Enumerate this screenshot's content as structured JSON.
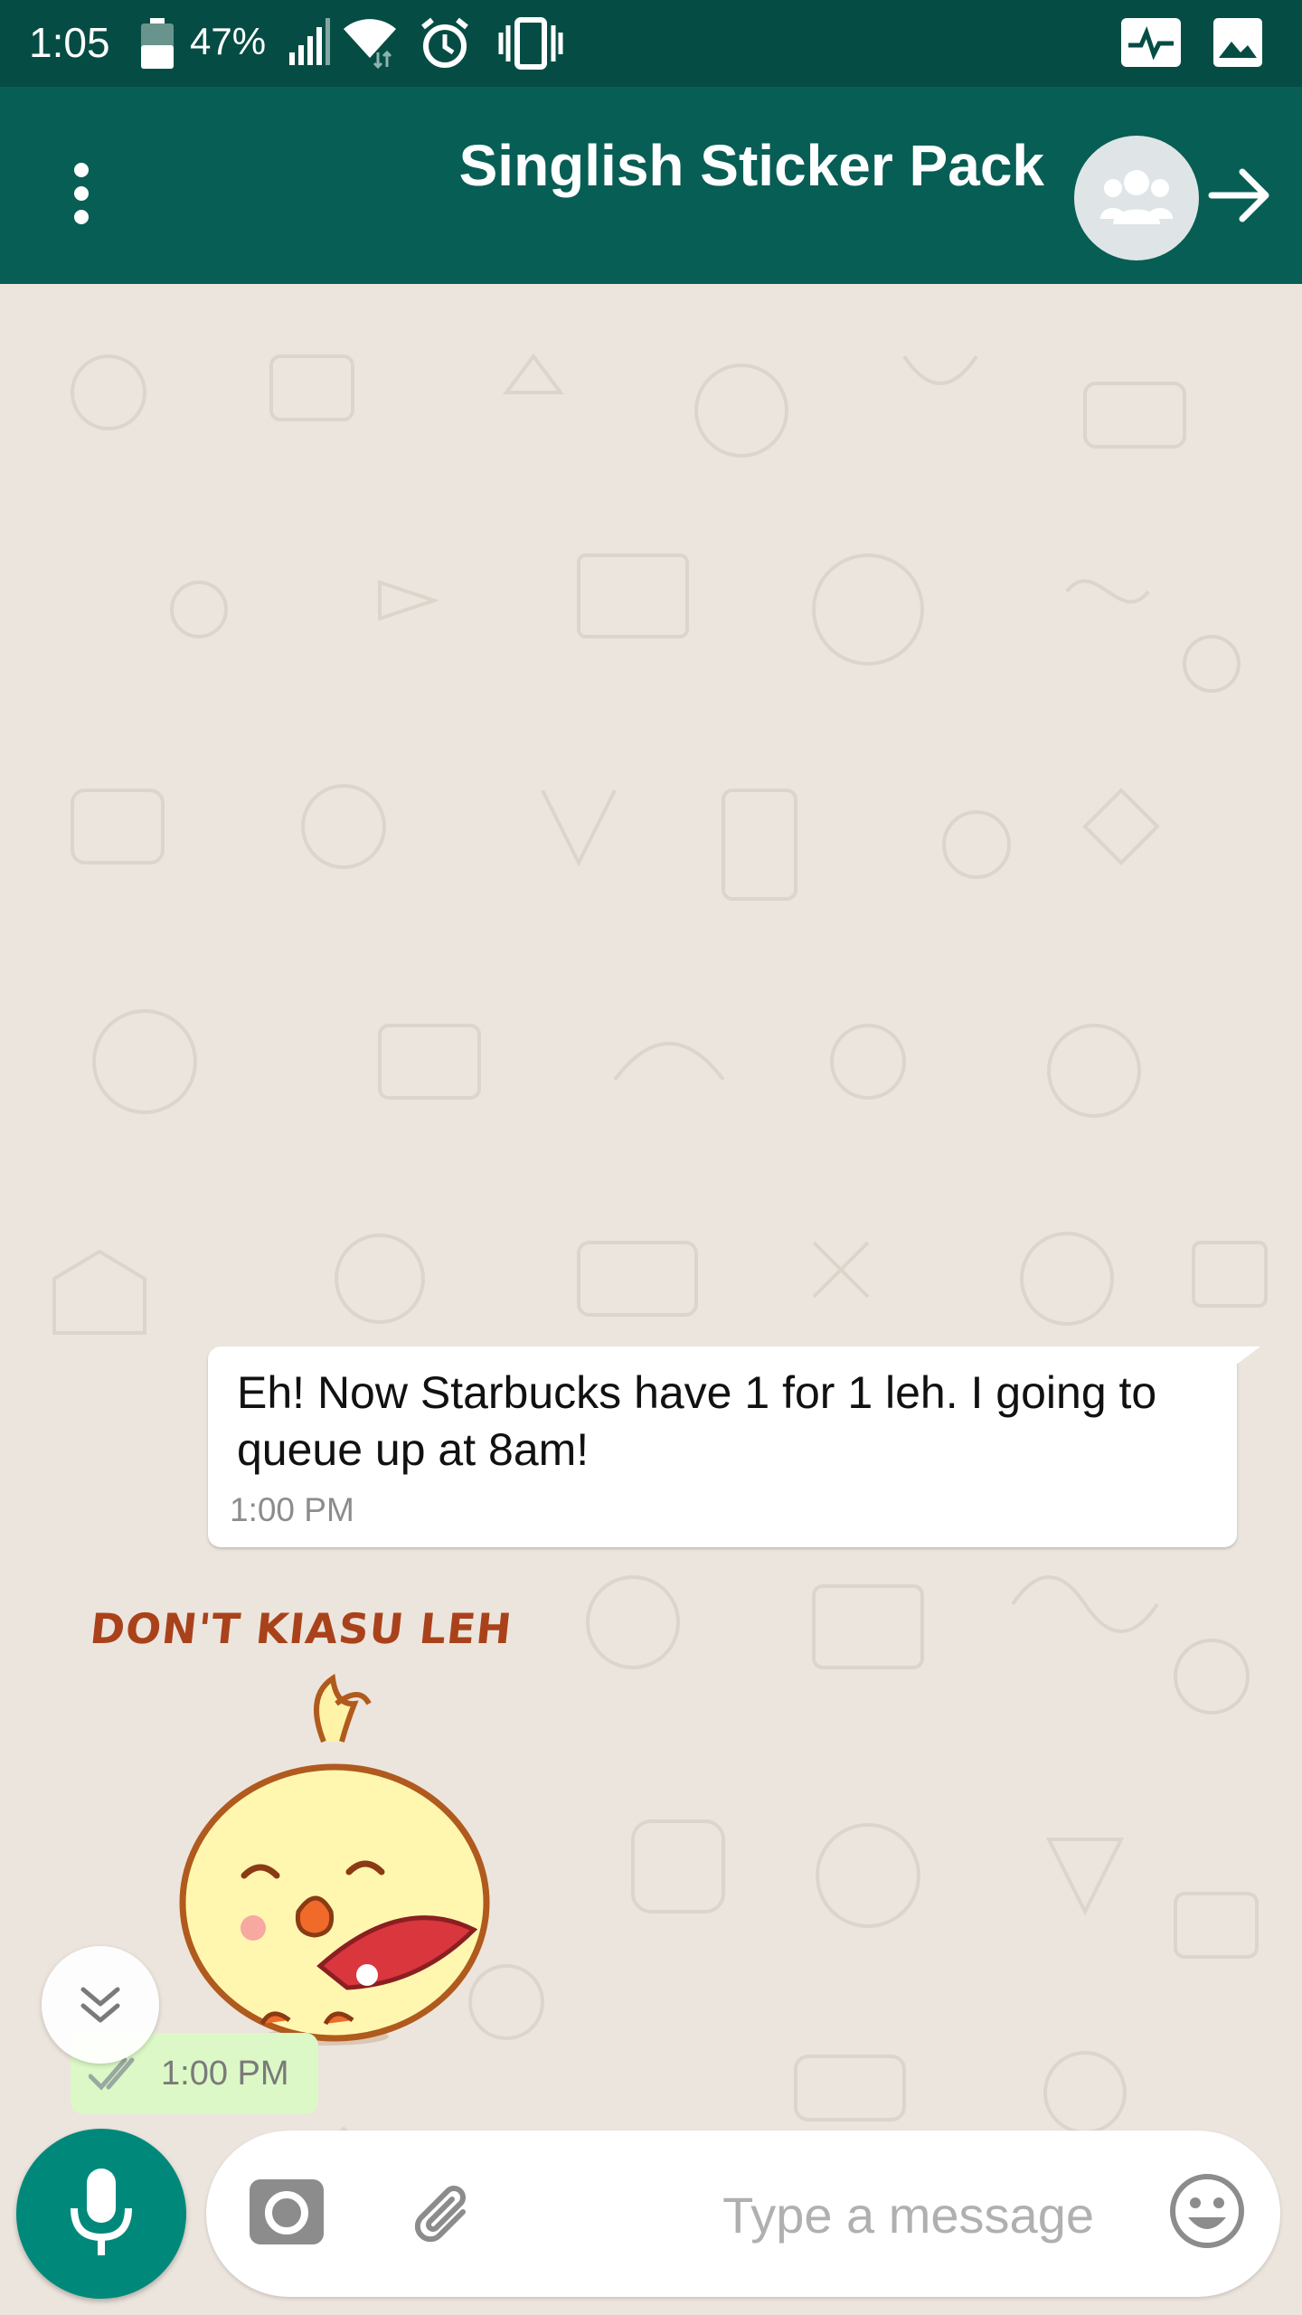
{
  "status_bar": {
    "time": "1:05",
    "battery_percent": "47%"
  },
  "app_bar": {
    "title": "Singlish Sticker Pack",
    "menu_icon": "more-vert-icon",
    "avatar_icon": "group-avatar-icon",
    "forward_icon": "arrow-right-icon"
  },
  "messages": [
    {
      "type": "text",
      "direction": "outgoing",
      "text": "Eh! Now Starbucks have 1 for 1 leh. I going to queue up at 8am!",
      "time": "1:00 PM"
    },
    {
      "type": "sticker",
      "direction": "incoming",
      "caption": "DON'T KIASU LEH",
      "time": "1:00 PM",
      "status_icon": "double-check-icon"
    }
  ],
  "input_bar": {
    "placeholder": "Type a message",
    "value": ""
  },
  "colors": {
    "status_bar": "#054d44",
    "app_bar": "#075e54",
    "chat_bg": "#ece5dd",
    "mic": "#00897b",
    "sticker_meta": "#dcf8c6"
  }
}
